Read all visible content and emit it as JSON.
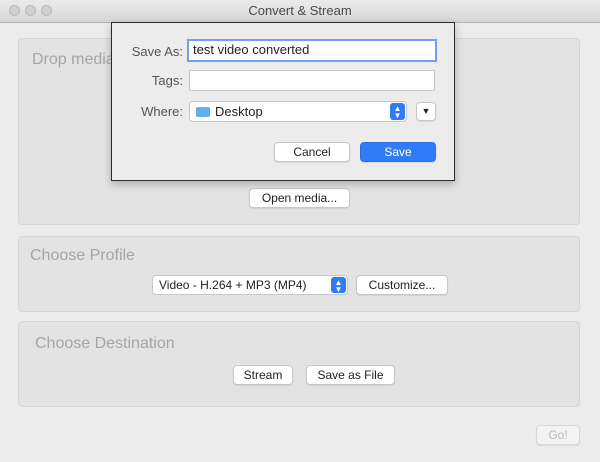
{
  "window": {
    "title": "Convert & Stream"
  },
  "sections": {
    "drop_media": {
      "title": "Drop media",
      "open_button": "Open media..."
    },
    "profile": {
      "title": "Choose Profile",
      "selected": "Video - H.264 + MP3 (MP4)",
      "customize_button": "Customize..."
    },
    "destination": {
      "title": "Choose Destination",
      "stream_button": "Stream",
      "save_file_button": "Save as File"
    }
  },
  "go_button": "Go!",
  "save_sheet": {
    "save_as_label": "Save As:",
    "save_as_value": "test video converted",
    "tags_label": "Tags:",
    "tags_value": "",
    "where_label": "Where:",
    "where_value": "Desktop",
    "where_icon": "folder-icon",
    "cancel_button": "Cancel",
    "save_button": "Save",
    "accent_color": "#2f7cf6"
  }
}
